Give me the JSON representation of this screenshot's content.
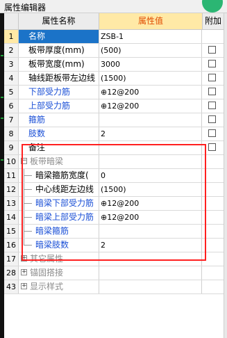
{
  "window": {
    "title": "属性编辑器"
  },
  "header": {
    "name": "属性名称",
    "value": "属性值",
    "add": "附加"
  },
  "rows": [
    {
      "num": "1",
      "name": "名称",
      "value": "ZSB-1",
      "has_checkbox": false
    },
    {
      "num": "2",
      "name": "板带厚度(mm)",
      "value": "(500)",
      "has_checkbox": true
    },
    {
      "num": "3",
      "name": "板带宽度(mm)",
      "value": "3000",
      "has_checkbox": true
    },
    {
      "num": "4",
      "name": "轴线距板带左边线",
      "value": "(1500)",
      "has_checkbox": true
    },
    {
      "num": "5",
      "name": "下部受力筋",
      "value": "⊕12@200",
      "has_checkbox": true
    },
    {
      "num": "6",
      "name": "上部受力筋",
      "value": "⊕12@200",
      "has_checkbox": true
    },
    {
      "num": "7",
      "name": "箍筋",
      "value": "",
      "has_checkbox": true
    },
    {
      "num": "8",
      "name": "肢数",
      "value": "2",
      "has_checkbox": true
    },
    {
      "num": "9",
      "name": "备注",
      "value": "",
      "has_checkbox": true
    },
    {
      "num": "10",
      "name": "板带暗梁",
      "expander": "−"
    },
    {
      "num": "11",
      "name": "暗梁箍筋宽度(",
      "value": "0"
    },
    {
      "num": "12",
      "name": "中心线距左边线",
      "value": "(1500)"
    },
    {
      "num": "13",
      "name": "暗梁下部受力筋",
      "value": "⊕12@200"
    },
    {
      "num": "14",
      "name": "暗梁上部受力筋",
      "value": "⊕12@200"
    },
    {
      "num": "15",
      "name": "暗梁箍筋",
      "value": ""
    },
    {
      "num": "16",
      "name": "暗梁肢数",
      "value": "2"
    },
    {
      "num": "17",
      "name": "其它属性",
      "expander": "+"
    },
    {
      "num": "28",
      "name": "锚固搭接",
      "expander": "+"
    },
    {
      "num": "43",
      "name": "显示样式",
      "expander": "+"
    }
  ]
}
